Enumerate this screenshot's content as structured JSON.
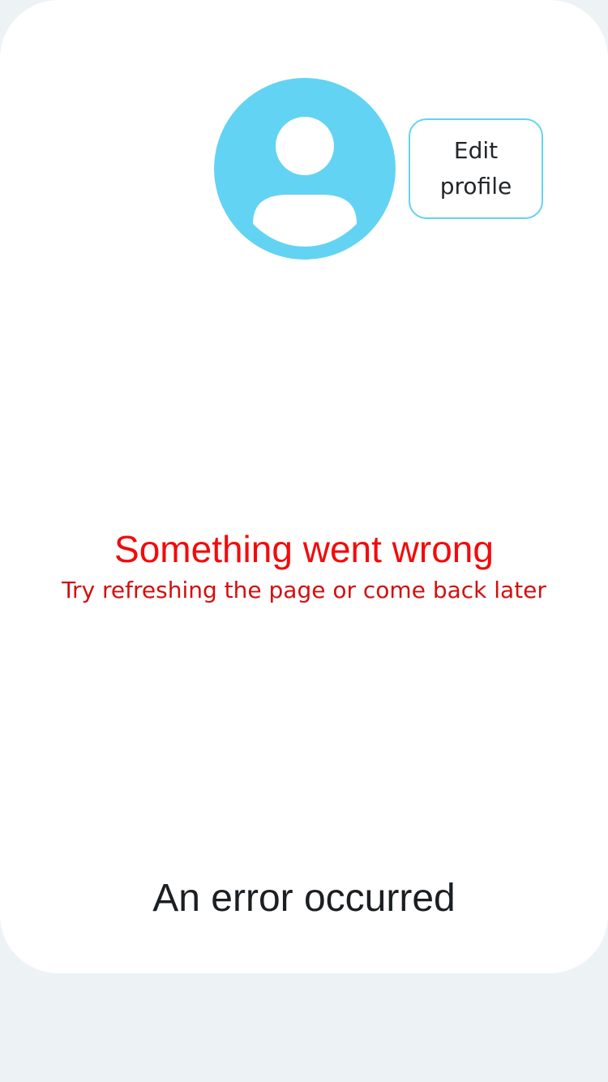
{
  "profile": {
    "avatar_icon": "user-avatar-icon",
    "avatar_color": "#62d3f3",
    "edit_button_label": "Edit profile"
  },
  "error": {
    "title": "Something went wrong",
    "subtitle": "Try refreshing the page or come back later",
    "color": "#f20b0b"
  },
  "footer": {
    "message": "An error occurred"
  }
}
